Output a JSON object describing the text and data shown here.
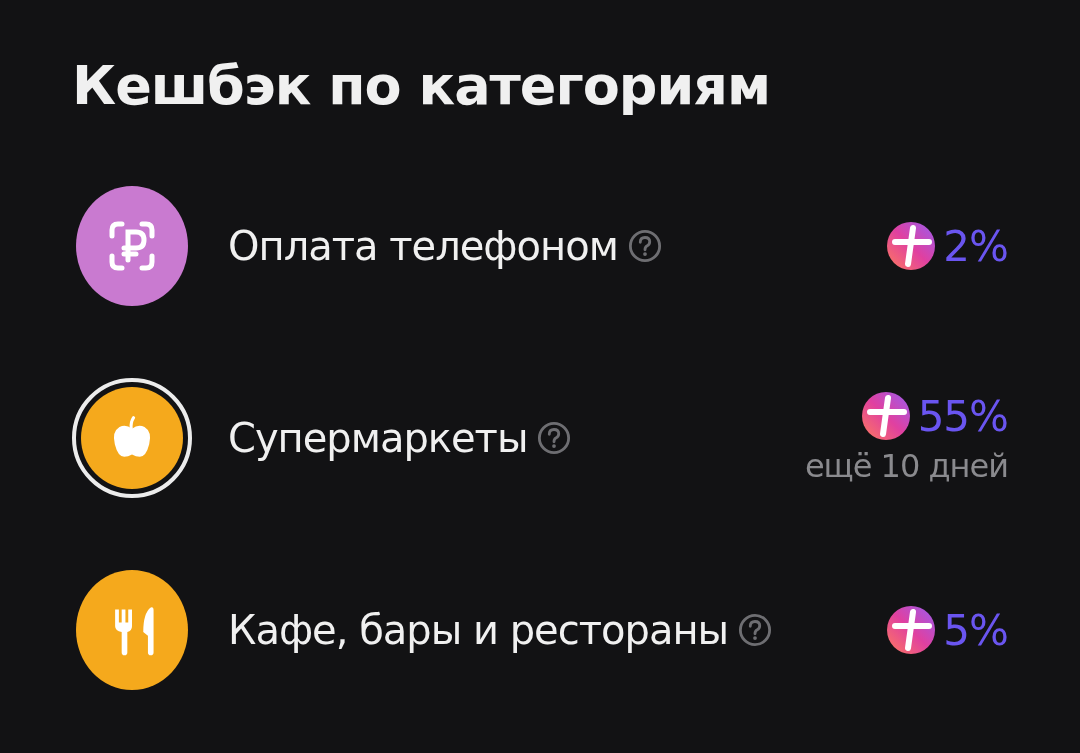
{
  "title": "Кешбэк по категориям",
  "categories": [
    {
      "kind": "phone-pay",
      "color": "#c97ad0",
      "selected": false,
      "name": "Оплата телефоном",
      "percent": "2%"
    },
    {
      "kind": "apple",
      "color": "#f5a91c",
      "selected": true,
      "name": "Супермаркеты",
      "percent": "55%",
      "note": "ещё 10 дней"
    },
    {
      "kind": "cutlery",
      "color": "#f5a91c",
      "selected": false,
      "name": "Кафе, бары и рестораны",
      "percent": "5%"
    }
  ]
}
